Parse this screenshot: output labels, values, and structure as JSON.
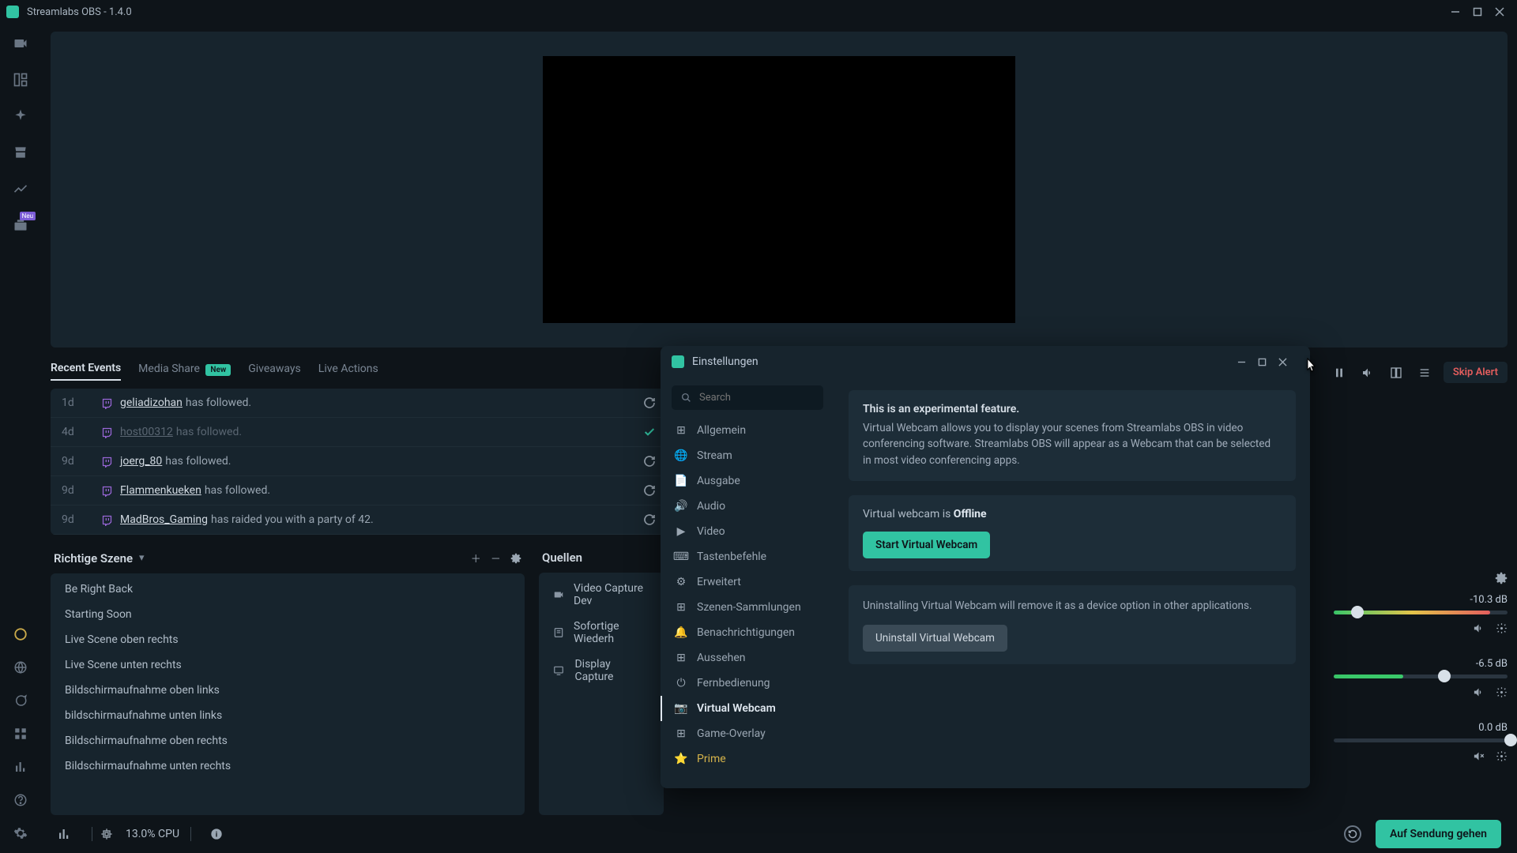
{
  "titlebar": {
    "title": "Streamlabs OBS - 1.4.0"
  },
  "tabs": {
    "recent": "Recent Events",
    "media": "Media Share",
    "media_badge": "New",
    "giveaways": "Giveaways",
    "live_actions": "Live Actions"
  },
  "events": [
    {
      "time": "1d",
      "user": "geliadizohan",
      "text": "has followed.",
      "dim": false,
      "right": "refresh"
    },
    {
      "time": "4d",
      "user": "host00312",
      "text": "has followed.",
      "dim": true,
      "right": "check"
    },
    {
      "time": "9d",
      "user": "joerg_80",
      "text": "has followed.",
      "dim": false,
      "right": "refresh"
    },
    {
      "time": "9d",
      "user": "Flammenkueken",
      "text": "has followed.",
      "dim": false,
      "right": "refresh"
    },
    {
      "time": "9d",
      "user": "MadBros_Gaming",
      "text": "has raided you with a party of 42.",
      "dim": false,
      "right": "refresh"
    }
  ],
  "scenes": {
    "title": "Richtige Szene",
    "items": [
      "Be Right Back",
      "Starting Soon",
      "Live Scene oben rechts",
      "Live Scene unten rechts",
      "Bildschirmaufnahme oben links",
      "bildschirmaufnahme unten links",
      "Bildschirmaufnahme oben rechts",
      "Bildschirmaufnahme unten rechts"
    ]
  },
  "sources": {
    "title": "Quellen",
    "items": [
      "Video Capture Dev",
      "Sofortige Wiederh",
      "Display Capture"
    ]
  },
  "toolbar": {
    "skip": "Skip Alert"
  },
  "mixer": [
    {
      "db": "-10.3 dB",
      "knob": 10,
      "fill": "linear-gradient(90deg,#3ac96a,#e3c44a,#e35d5d)",
      "fillw": 90,
      "strike": false
    },
    {
      "db": "-6.5 dB",
      "knob": 60,
      "fill": "#3ac96a",
      "fillw": 40,
      "strike": false
    },
    {
      "db": "0.0 dB",
      "knob": 98,
      "fill": "",
      "fillw": 0,
      "strike": true
    }
  ],
  "footer": {
    "cpu": "13.0% CPU",
    "golive": "Auf Sendung gehen"
  },
  "modal": {
    "title": "Einstellungen",
    "search_placeholder": "Search",
    "nav": [
      "Allgemein",
      "Stream",
      "Ausgabe",
      "Audio",
      "Video",
      "Tastenbefehle",
      "Erweitert",
      "Szenen-Sammlungen",
      "Benachrichtigungen",
      "Aussehen",
      "Fernbedienung",
      "Virtual Webcam",
      "Game-Overlay",
      "Prime"
    ],
    "content": {
      "exp_title": "This is an experimental feature.",
      "exp_body": "Virtual Webcam allows you to display your scenes from Streamlabs OBS in video conferencing software. Streamlabs OBS will appear as a Webcam that can be selected in most video conferencing apps.",
      "status_pre": "Virtual webcam is ",
      "status_val": "Offline",
      "start_btn": "Start Virtual Webcam",
      "uninstall_body": "Uninstalling Virtual Webcam will remove it as a device option in other applications.",
      "uninstall_btn": "Uninstall Virtual Webcam"
    }
  },
  "rail_badge": "Neu"
}
